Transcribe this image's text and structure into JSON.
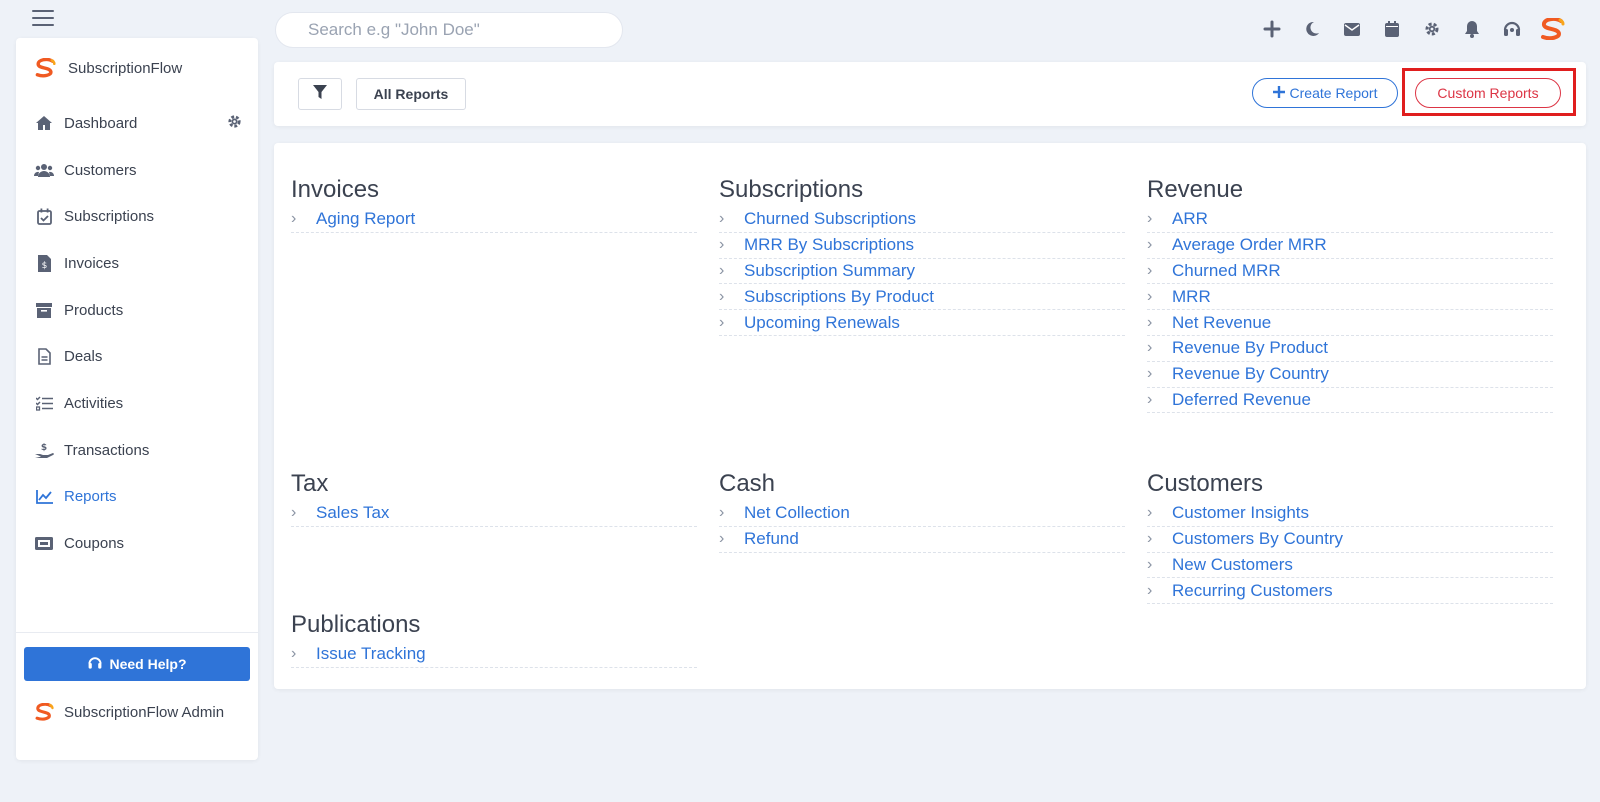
{
  "search": {
    "placeholder": "Search e.g \"John Doe\""
  },
  "topbar": {
    "icons": [
      "plus-icon",
      "moon-icon",
      "mail-icon",
      "calendar-icon",
      "gear-icon",
      "bell-icon",
      "headset-icon",
      "brand-logo"
    ]
  },
  "sidebar": {
    "brand": "SubscriptionFlow",
    "items": [
      {
        "label": "Dashboard",
        "icon": "home-icon"
      },
      {
        "label": "Customers",
        "icon": "users-icon"
      },
      {
        "label": "Subscriptions",
        "icon": "calendar-check-icon"
      },
      {
        "label": "Invoices",
        "icon": "invoice-icon"
      },
      {
        "label": "Products",
        "icon": "archive-icon"
      },
      {
        "label": "Deals",
        "icon": "document-icon"
      },
      {
        "label": "Activities",
        "icon": "tasks-icon"
      },
      {
        "label": "Transactions",
        "icon": "hand-dollar-icon"
      },
      {
        "label": "Reports",
        "icon": "chart-line-icon",
        "active": true
      },
      {
        "label": "Coupons",
        "icon": "ticket-icon"
      }
    ],
    "help_label": "Need Help?",
    "admin_label": "SubscriptionFlow Admin"
  },
  "toolbar": {
    "all_reports": "All Reports",
    "create_report": "Create Report",
    "custom_reports": "Custom Reports"
  },
  "colors": {
    "accent": "#2f74d8",
    "danger": "#dc3545",
    "highlight": "#e01e1e",
    "background": "#eef2f8"
  },
  "sections": {
    "invoices": {
      "title": "Invoices",
      "items": [
        "Aging Report"
      ]
    },
    "subscriptions": {
      "title": "Subscriptions",
      "items": [
        "Churned Subscriptions",
        "MRR By Subscriptions",
        "Subscription Summary",
        "Subscriptions By Product",
        "Upcoming Renewals"
      ]
    },
    "revenue": {
      "title": "Revenue",
      "items": [
        "ARR",
        "Average Order MRR",
        "Churned MRR",
        "MRR",
        "Net Revenue",
        "Revenue By Product",
        "Revenue By Country",
        "Deferred Revenue"
      ]
    },
    "tax": {
      "title": "Tax",
      "items": [
        "Sales Tax"
      ]
    },
    "cash": {
      "title": "Cash",
      "items": [
        "Net Collection",
        "Refund"
      ]
    },
    "customers": {
      "title": "Customers",
      "items": [
        "Customer Insights",
        "Customers By Country",
        "New Customers",
        "Recurring Customers"
      ]
    },
    "publications": {
      "title": "Publications",
      "items": [
        "Issue Tracking"
      ]
    }
  }
}
